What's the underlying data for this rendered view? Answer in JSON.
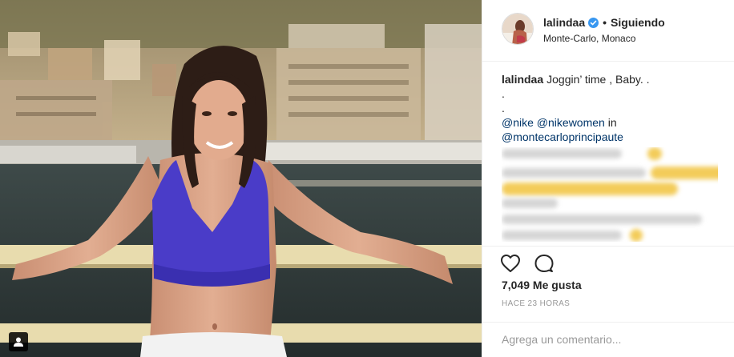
{
  "post": {
    "username": "lalindaa",
    "verified": true,
    "separator": "•",
    "follow_status": "Siguiendo",
    "location": "Monte-Carlo, Monaco"
  },
  "caption": {
    "username": "lalindaa",
    "text": "Joggin’ time , Baby. .",
    "line2": ".",
    "line3": ".",
    "mention1": "@nike",
    "mention2": "@nikewomen",
    "word_in": "in",
    "mention3": "@montecarloprincipaute"
  },
  "actions": {
    "likes": "7,049 Me gusta",
    "time_ago": "Hace 23 horas"
  },
  "comment_input": {
    "placeholder": "Agrega un comentario..."
  },
  "colors": {
    "text": "#262626",
    "mention": "#003569",
    "secondary": "#999999",
    "verified": "#3897f0",
    "border": "#efefef"
  }
}
